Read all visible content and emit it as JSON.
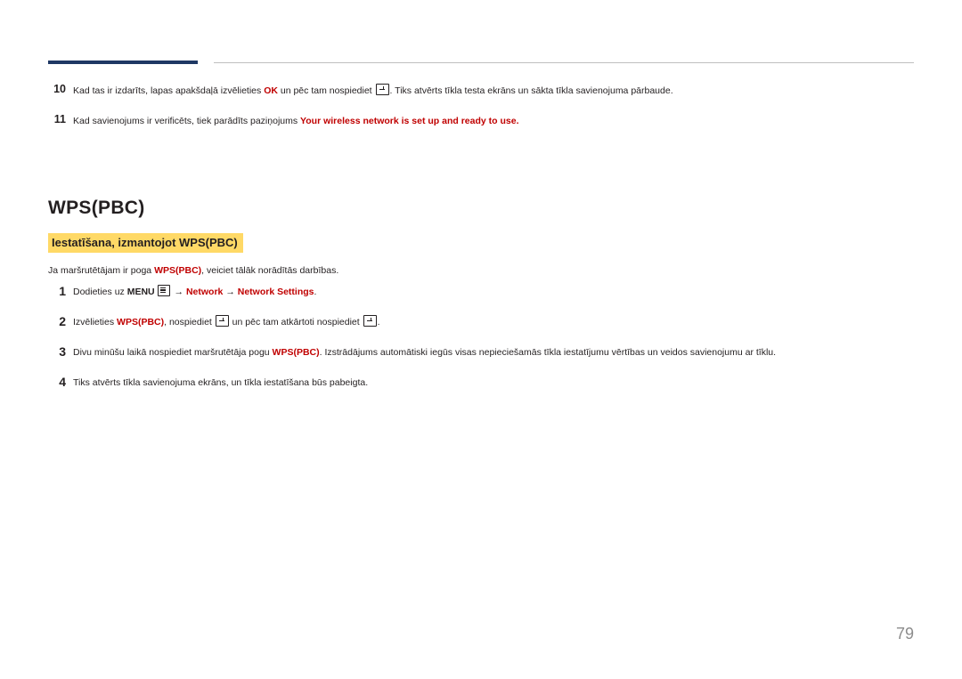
{
  "document": {
    "page_number": "79",
    "title": "WPS(PBC)",
    "subheading": "Iestatīšana, izmantojot WPS(PBC)",
    "intro_prefix": "Ja maršrutētājam ir poga ",
    "intro_bold": "WPS(PBC)",
    "intro_suffix": ", veiciet tālāk norādītās darbības.",
    "continued_items": [
      {
        "number": "10",
        "parts": [
          {
            "text": "Kad tas ir izdarīts, lapas apakšdaļā izvēlieties ",
            "style": "normal"
          },
          {
            "text": "OK",
            "style": "red"
          },
          {
            "text": " un pēc tam nospiediet ",
            "style": "normal"
          },
          {
            "text": "enter-key-icon",
            "style": "key"
          },
          {
            "text": ". Tiks atvērts tīkla testa ekrāns un sākta tīkla savienojuma pārbaude.",
            "style": "normal"
          }
        ]
      },
      {
        "number": "11",
        "parts": [
          {
            "text": "Kad savienojums ir verificēts, tiek parādīts paziņojums ",
            "style": "normal"
          },
          {
            "text": "Your wireless network is set up and ready to use.",
            "style": "red"
          },
          {
            "text": ".",
            "style": "normal"
          }
        ]
      }
    ],
    "steps": [
      {
        "number": "1",
        "parts": [
          {
            "text": "Dodieties uz ",
            "style": "normal"
          },
          {
            "text": "MENU",
            "style": "bold"
          },
          {
            "text": "menu-key-icon",
            "style": "keymenu"
          },
          {
            "text": " → ",
            "style": "normal"
          },
          {
            "text": "Network",
            "style": "red"
          },
          {
            "text": " → ",
            "style": "normal"
          },
          {
            "text": "Network Settings",
            "style": "red"
          },
          {
            "text": ".",
            "style": "normal"
          }
        ]
      },
      {
        "number": "2",
        "parts": [
          {
            "text": "Izvēlieties ",
            "style": "normal"
          },
          {
            "text": "WPS(PBC)",
            "style": "red"
          },
          {
            "text": ", nospiediet ",
            "style": "normal"
          },
          {
            "text": "enter-key-icon",
            "style": "key"
          },
          {
            "text": " un pēc tam atkārtoti nospiediet ",
            "style": "normal"
          },
          {
            "text": "enter-key-icon",
            "style": "key"
          },
          {
            "text": ".",
            "style": "normal"
          }
        ]
      },
      {
        "number": "3",
        "parts": [
          {
            "text": "Divu minūšu laikā nospiediet maršrutētāja pogu ",
            "style": "normal"
          },
          {
            "text": "WPS(PBC)",
            "style": "red"
          },
          {
            "text": ". Izstrādājums automātiski iegūs visas nepieciešamās tīkla iestatījumu vērtības un veidos savienojumu ar tīklu.",
            "style": "normal"
          }
        ]
      },
      {
        "number": "4",
        "parts": [
          {
            "text": "Tiks atvērts tīkla savienojuma ekrāns, un tīkla iestatīšana būs pabeigta.",
            "style": "normal"
          }
        ]
      }
    ],
    "colors": {
      "accent_bar": "#1f3864",
      "highlight": "#ffd966",
      "emphasis_text": "#c00000",
      "body_text": "#231f20",
      "page_number": "#8c8c8c"
    }
  }
}
